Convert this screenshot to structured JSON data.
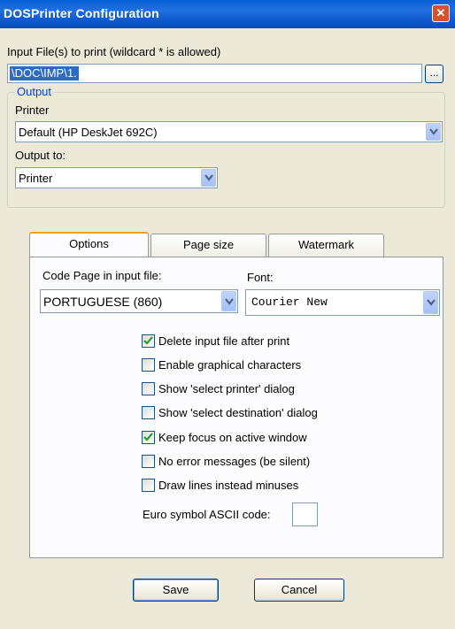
{
  "window": {
    "title": "DOSPrinter Configuration",
    "close_glyph": "✕"
  },
  "input": {
    "label": "Input File(s) to print (wildcard * is allowed)",
    "value": "\\DOC\\IMP\\1.",
    "browse_label": "..."
  },
  "output": {
    "group_label": "Output",
    "printer_label": "Printer",
    "printer_value": "Default (HP DeskJet 692C)",
    "output_to_label": "Output to:",
    "output_to_value": "Printer"
  },
  "tabs": [
    {
      "label": "Options",
      "active": true
    },
    {
      "label": "Page size",
      "active": false
    },
    {
      "label": "Watermark",
      "active": false
    }
  ],
  "options": {
    "code_page_label": "Code Page in input file:",
    "code_page_value": "PORTUGUESE (860)",
    "font_label": "Font:",
    "font_value": "Courier New",
    "checkboxes": [
      {
        "label": "Delete input file after print",
        "checked": true
      },
      {
        "label": "Enable graphical characters",
        "checked": false
      },
      {
        "label": "Show 'select printer' dialog",
        "checked": false
      },
      {
        "label": "Show 'select destination' dialog",
        "checked": false
      },
      {
        "label": "Keep focus on active window",
        "checked": true
      },
      {
        "label": "No error messages (be silent)",
        "checked": false
      },
      {
        "label": "Draw lines instead minuses",
        "checked": false
      }
    ],
    "euro_label": "Euro symbol ASCII code:",
    "euro_value": ""
  },
  "buttons": {
    "save_label": "Save",
    "cancel_label": "Cancel"
  },
  "colors": {
    "titlebar": "#0a5fd6",
    "group_label": "#0046d5",
    "tab_highlight": "#f3a12b"
  }
}
